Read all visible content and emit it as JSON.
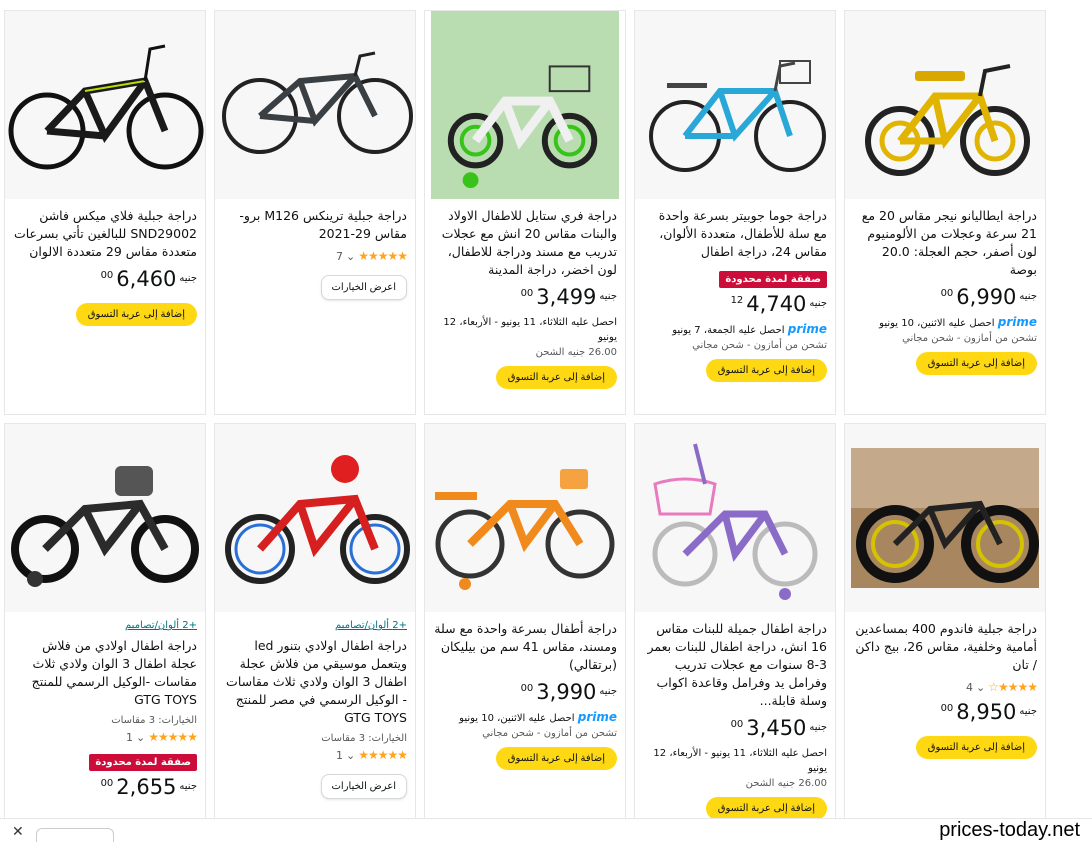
{
  "products": [
    {
      "title": "دراجة ايطاليانو نيجر مقاس 20 مع 21 سرعة وعجلات من الألومنيوم لون أصفر، حجم العجلة: 20.0 بوصة",
      "price_whole": "6,990",
      "price_frac": "00",
      "currency": "جنيه",
      "prime_logo": "prime",
      "prime_text": "احصل عليه الاثنين، 10 يونيو",
      "shipping": "تشحن من أمازون - شحن مجاني",
      "cart_label": "إضافة إلى عربة التسوق",
      "bike_color": "#e0b400"
    },
    {
      "title": "دراجة جوما جوبيتر بسرعة واحدة مع سلة للأطفال، متعددة الألوان، مقاس 24، دراجة اطفال",
      "deal": "صفقة لمدة محدودة",
      "price_whole": "4,740",
      "price_frac": "12",
      "currency": "جنيه",
      "prime_logo": "prime",
      "prime_text": "احصل عليه الجمعة، 7 يونيو",
      "shipping": "تشحن من أمازون - شحن مجاني",
      "cart_label": "إضافة إلى عربة التسوق",
      "bike_color": "#29a8d8"
    },
    {
      "title": "دراجة فري ستايل للاطفال الاولاد والبنات مقاس 20 انش مع عجلات تدريب مع مسند ودراجة للاطفال، لون اخضر، دراجة المدينة",
      "price_whole": "3,499",
      "price_frac": "00",
      "currency": "جنيه",
      "delivery": "احصل عليه الثلاثاء، 11 يونيو - الأربعاء، 12 يونيو",
      "shipping_fee": "26.00 جنيه الشحن",
      "cart_label": "إضافة إلى عربة التسوق",
      "bike_color": "#e8e8e8"
    },
    {
      "title": "دراجة جبلية ترينكس M126 برو-مقاس 29-2021",
      "rating_stars": "★★★★★",
      "rating_count": "7",
      "options_label": "اعرض الخيارات",
      "bike_color": "#3a3f44"
    },
    {
      "title": "دراجة جبلية فلاي ميكس فاشن SND29002 للبالغين تأتي بسرعات متعددة مقاس 29 متعددة الالوان",
      "price_whole": "6,460",
      "price_frac": "00",
      "currency": "جنيه",
      "cart_label": "إضافة إلى عربة التسوق",
      "bike_color": "#1a1a1a"
    },
    {
      "title": "دراجة جبلية فاندوم 400 بمساعدين أمامية وخلفية، مقاس 26، بيج داكن / تان",
      "rating_stars": "★★★★☆",
      "rating_count": "4",
      "price_whole": "8,950",
      "price_frac": "00",
      "currency": "جنيه",
      "cart_label": "إضافة إلى عربة التسوق",
      "bike_color": "#d4c300"
    },
    {
      "title": "دراجة اطفال جميلة للبنات مقاس 16 انش، دراجة اطفال للبنات بعمر 3-8 سنوات مع عجلات تدريب وفرامل يد وفرامل وقاعدة اكواب وسلة قابلة...",
      "price_whole": "3,450",
      "price_frac": "00",
      "currency": "جنيه",
      "delivery": "احصل عليه الثلاثاء، 11 يونيو - الأربعاء، 12 يونيو",
      "shipping_fee": "26.00 جنيه الشحن",
      "cart_label": "إضافة إلى عربة التسوق",
      "bike_color": "#8a6bc8"
    },
    {
      "title": "دراجة أطفال بسرعة واحدة مع سلة ومسند، مقاس 41 سم من بيليكان (برتقالي)",
      "price_whole": "3,990",
      "price_frac": "00",
      "currency": "جنيه",
      "prime_logo": "prime",
      "prime_text": "احصل عليه الاثنين، 10 يونيو",
      "shipping": "تشحن من أمازون - شحن مجاني",
      "cart_label": "إضافة إلى عربة التسوق",
      "bike_color": "#f08a1c"
    },
    {
      "colors_link": "+2 ألوان/تصاميم",
      "title": "دراجة اطفال اولادي بتنور led ويتعمل موسيقي من فلاش عجلة اطفال 3 الوان ولادي ثلاث مقاسات - الوكيل الرسمي في مصر للمنتج GTG TOYS",
      "options_count": "الخيارات: 3 مقاسات",
      "rating_stars": "★★★★★",
      "rating_count": "1",
      "options_label": "اعرض الخيارات",
      "bike_color": "#d62020"
    },
    {
      "colors_link": "+2 ألوان/تصاميم",
      "title": "دراجة اطفال اولادي من فلاش عجلة اطفال 3 الوان ولادي ثلاث مقاسات -الوكيل الرسمي للمنتج GTG TOYS",
      "options_count": "الخيارات: 3 مقاسات",
      "rating_stars": "★★★★★",
      "rating_count": "1",
      "deal": "صفقة لمدة محدودة",
      "price_whole": "2,655",
      "price_frac": "00",
      "currency": "جنيه",
      "bike_color": "#2b2b2b"
    }
  ],
  "watermark": "prices-today.net",
  "close_icon": "close-icon"
}
